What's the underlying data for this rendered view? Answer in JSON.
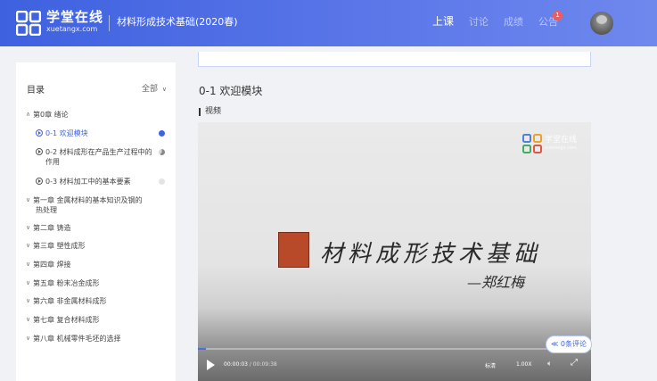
{
  "header": {
    "logo_cn": "学堂在线",
    "logo_en": "xuetangx.com",
    "course_title": "材料形成技术基础(2020春)",
    "nav": {
      "lessons": "上课",
      "discussion": "讨论",
      "grades": "成绩",
      "announcements": "公告",
      "announcements_badge": "1"
    }
  },
  "sidebar": {
    "title": "目录",
    "filter": "全部",
    "chapter0": {
      "label": "第0章 绪论",
      "expanded": true
    },
    "lessons": [
      {
        "label": "0-1 欢迎模块",
        "active": true,
        "status_color": "#3d63e0"
      },
      {
        "label_line1": "0-2 材料成形在产品生产过程中的",
        "label_line2": "作用",
        "status_color": "#8a8a8a"
      },
      {
        "label": "0-3 材料加工中的基本要素",
        "status_color": "#e4e4e4"
      }
    ],
    "chapters": [
      {
        "line1": "第一章 金属材料的基本知识及钢的",
        "line2": "热处理"
      },
      {
        "label": "第二章 铸造"
      },
      {
        "label": "第三章 塑性成形"
      },
      {
        "label": "第四章 焊接"
      },
      {
        "label": "第五章 粉末冶金成形"
      },
      {
        "label": "第六章 非金属材料成形"
      },
      {
        "label": "第七章 复合材料成形"
      },
      {
        "label": "第八章 机械零件毛坯的选择"
      }
    ]
  },
  "main": {
    "module_title": "0-1 欢迎模块",
    "section_label": "视频",
    "video": {
      "watermark_text": "学堂在线",
      "watermark_sub": "xuetangx.com",
      "title_text": "材料成形技术基础",
      "author_text": "—郑红梅",
      "current_time": "00:00:03",
      "separator": " / ",
      "duration": "00:09:38",
      "progress_fraction": 0.005,
      "quality": "标清",
      "speed": "1.00X"
    },
    "comments_button": "≪ 0条评论"
  },
  "colors": {
    "header_start": "#3e61e0",
    "header_end": "#6f88ee",
    "accent": "#3d63e0",
    "badge": "#f35a5a"
  }
}
